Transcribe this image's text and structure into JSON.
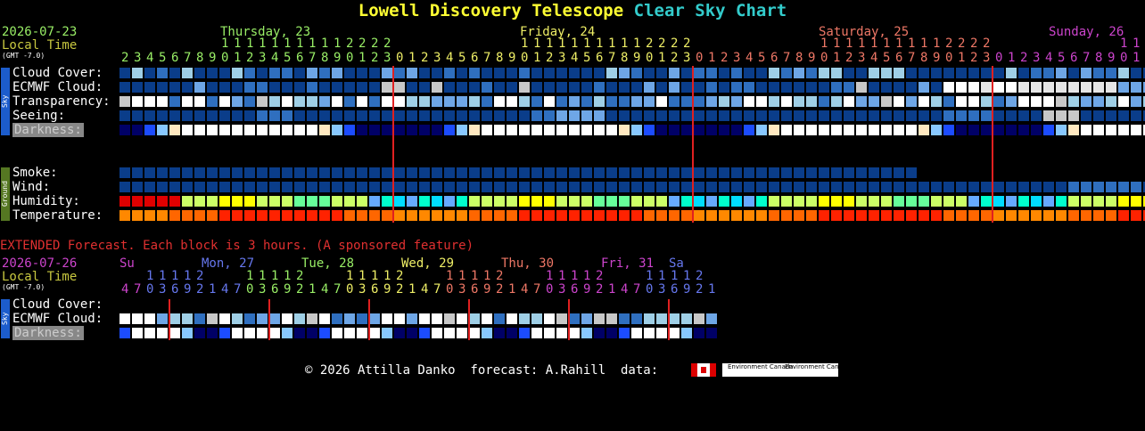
{
  "title_a": "Lowell Discovery Telescope",
  "title_b": "Clear Sky Chart",
  "date_label": "2026-07-23",
  "local_time_label": "Local Time",
  "gmt_label": "(GMT -7.0)",
  "days": [
    {
      "label": "Thursday, 23",
      "color": "#99ee66"
    },
    {
      "label": "Friday, 24",
      "color": "#eeee66"
    },
    {
      "label": "Saturday, 25",
      "color": "#ee7766"
    },
    {
      "label": "Sunday, 26",
      "color": "#cc44cc"
    }
  ],
  "hour_tens": "           11111111111112222  ",
  "hours_start": 2,
  "hours_count": 96,
  "rows": {
    "cloud": "Cloud Cover:",
    "ecmwf": "ECMWF Cloud:",
    "transparency": "Transparency:",
    "seeing": "Seeing:",
    "darkness": "Darkness:",
    "smoke": "Smoke:",
    "wind": "Wind:",
    "humidity": "Humidity:",
    "temperature": "Temperature:"
  },
  "side_sky": "Sky",
  "side_ground": "Ground",
  "extended_note": "EXTENDED Forecast. Each block is 3 hours. (A sponsored feature)",
  "ext_date_label": "2026-07-26",
  "ext_days": [
    {
      "label": "Su",
      "color": "#cc44cc"
    },
    {
      "label": "Mon, 27",
      "color": "#6677ee"
    },
    {
      "label": "Tue, 28",
      "color": "#99ee66"
    },
    {
      "label": "Wed, 29",
      "color": "#eeee66"
    },
    {
      "label": "Thu, 30",
      "color": "#ee7766"
    },
    {
      "label": "Fri, 31",
      "color": "#cc44cc"
    },
    {
      "label": "Sa",
      "color": "#6677ee"
    }
  ],
  "ext_rows": {
    "cloud": "Cloud Cover:",
    "ecmwf": "ECMWF Cloud:",
    "darkness": "Darkness:"
  },
  "footer": "© 2026 Attilla Danko  forecast: A.Rahill  data:",
  "env_canada": "Environment Canada",
  "colors": {
    "deep_blue": "#0a3d8a",
    "mid_blue": "#2f6fbf",
    "light_blue": "#6ea6e6",
    "pale": "#9fcfe6",
    "white": "#ffffff",
    "grey": "#c8c8c8",
    "red_line": "#e02020"
  }
}
